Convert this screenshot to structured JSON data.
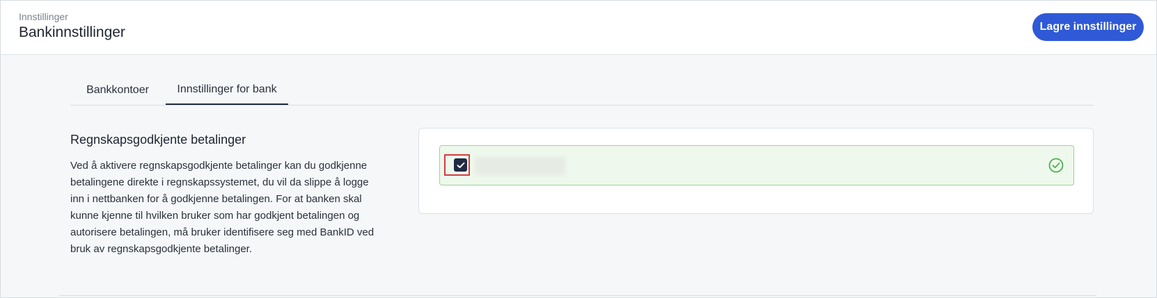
{
  "header": {
    "breadcrumb": "Innstillinger",
    "title": "Bankinnstillinger",
    "save_label": "Lagre innstillinger"
  },
  "tabs": [
    {
      "label": "Bankkontoer",
      "active": false
    },
    {
      "label": "Innstillinger for bank",
      "active": true
    }
  ],
  "section": {
    "title": "Regnskapsgodkjente betalinger",
    "description": "Ved å aktivere regnskapsgodkjente betalinger kan du godkjenne betalingene direkte i regnskapssystemet, du vil da slippe å logge inn i nettbanken for å godkjenne betalingen. For at banken skal kunne kjenne til hvilken bruker som har godkjent betalingen og autorisere betalingen, må bruker identifisere seg med BankID ved bruk av regnskapsgodkjente betalinger."
  },
  "account": {
    "checked": true,
    "check_icon": "check-icon",
    "status_icon": "check-circle-icon"
  },
  "colors": {
    "primary": "#2f59d6",
    "success_border": "#9bd49a",
    "success_bg": "#eef8ec",
    "success_icon": "#4caf50",
    "highlight": "#d43d3d"
  }
}
